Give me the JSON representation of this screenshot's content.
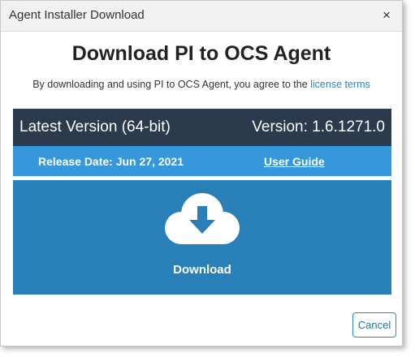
{
  "dialog": {
    "title": "Agent Installer Download",
    "close_glyph": "×",
    "close_icon": "close-icon"
  },
  "main": {
    "heading": "Download PI to OCS Agent",
    "agreement_prefix": "By downloading and using PI to OCS Agent, you agree to the ",
    "license_link": "license terms"
  },
  "version": {
    "label": "Latest Version (64-bit)",
    "value": "Version: 1.6.1271.0"
  },
  "release": {
    "date": "Release Date: Jun 27, 2021",
    "user_guide": "User Guide"
  },
  "download": {
    "label": "Download",
    "icon": "cloud-download-icon"
  },
  "footer": {
    "cancel_label": "Cancel"
  },
  "colors": {
    "version_bar": "#2c3a4d",
    "release_bar": "#3498db",
    "download_area": "#2980b9",
    "link": "#2e86c1"
  }
}
